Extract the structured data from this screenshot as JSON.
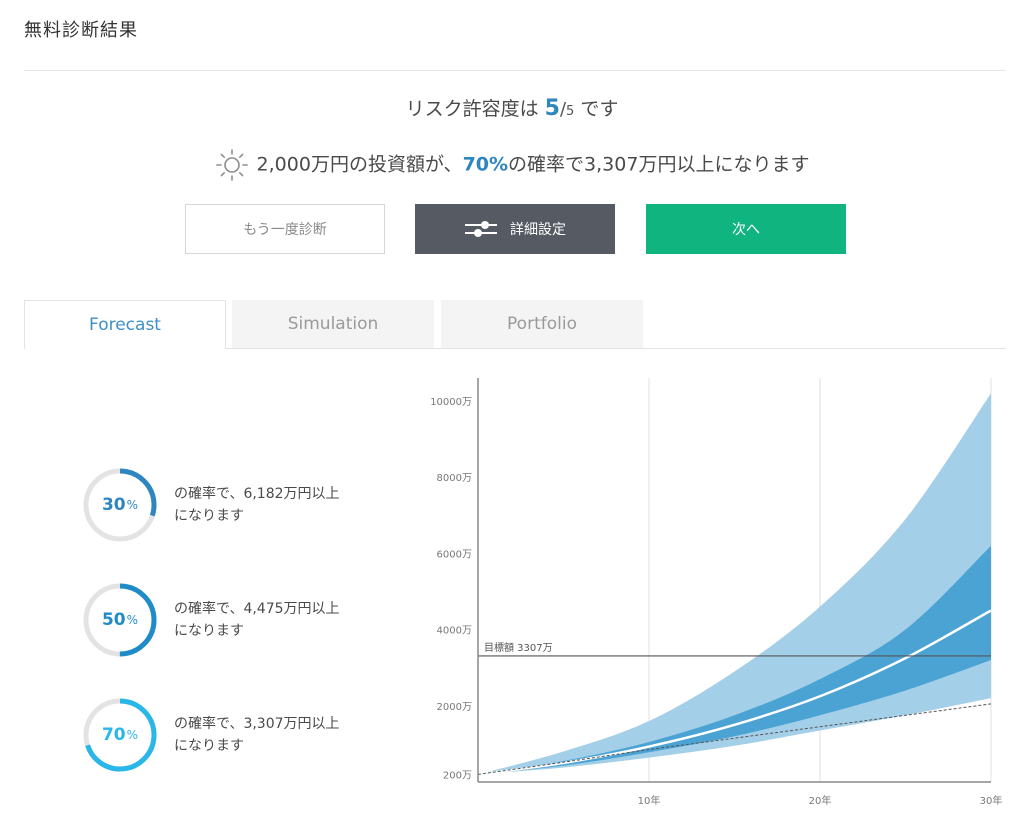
{
  "header": {
    "title": "無料診断結果"
  },
  "risk": {
    "prefix": "リスク許容度は",
    "value": "5",
    "slash": "/",
    "max": "5",
    "suffix": "です"
  },
  "forecast_line": {
    "icon": "sun-icon",
    "amount": "2,000万円の投資額が、",
    "probability": "70%",
    "suffix": "の確率で3,307万円以上になります"
  },
  "buttons": {
    "retry": "もう一度診断",
    "settings": "詳細設定",
    "next": "次へ"
  },
  "tabs": [
    {
      "label": "Forecast",
      "active": true
    },
    {
      "label": "Simulation",
      "active": false
    },
    {
      "label": "Portfolio",
      "active": false
    }
  ],
  "probabilities": [
    {
      "percent": "30",
      "unit": "%",
      "value": 0.3,
      "color": "#2e86c1",
      "line1": "の確率で、6,182万円以上",
      "line2": "になります"
    },
    {
      "percent": "50",
      "unit": "%",
      "value": 0.5,
      "color": "#1f8bc9",
      "line1": "の確率で、4,475万円以上",
      "line2": "になります"
    },
    {
      "percent": "70",
      "unit": "%",
      "value": 0.7,
      "color": "#29b6e8",
      "line1": "の確率で、3,307万円以上",
      "line2": "になります"
    }
  ],
  "colors": {
    "accent": "#2e86c1",
    "next_button": "#0fb47f",
    "settings_button": "#565b63",
    "band_outer": "#a4cfe8",
    "band_inner": "#4ba3d3",
    "median": "#ffffff"
  },
  "chart_data": {
    "type": "area",
    "y_ticks": [
      "200万",
      "2000万",
      "4000万",
      "6000万",
      "8000万",
      "10000万"
    ],
    "y_tick_values": [
      200,
      2000,
      4000,
      6000,
      8000,
      10000
    ],
    "x_ticks": [
      "10年",
      "20年",
      "30年"
    ],
    "x_tick_values": [
      10,
      20,
      30
    ],
    "xlim": [
      0,
      30
    ],
    "ylim": [
      0,
      10600
    ],
    "target_label": "目標額 3307万",
    "target_value": 3307,
    "x": [
      0,
      5,
      10,
      15,
      20,
      25,
      30
    ],
    "series": [
      {
        "role": "outer_upper",
        "values": [
          200,
          800,
          1600,
          2900,
          4600,
          6900,
          10200
        ]
      },
      {
        "role": "inner_upper",
        "values": [
          200,
          550,
          1050,
          1750,
          2700,
          4000,
          6200
        ]
      },
      {
        "role": "median",
        "values": [
          200,
          500,
          930,
          1500,
          2250,
          3250,
          4500
        ]
      },
      {
        "role": "inner_lower",
        "values": [
          200,
          430,
          780,
          1200,
          1750,
          2400,
          3200
        ]
      },
      {
        "role": "outer_lower",
        "values": [
          200,
          380,
          640,
          950,
          1350,
          1750,
          2200
        ]
      },
      {
        "role": "principal",
        "values": [
          200,
          520,
          850,
          1150,
          1450,
          1750,
          2050
        ]
      }
    ],
    "grid": true
  }
}
